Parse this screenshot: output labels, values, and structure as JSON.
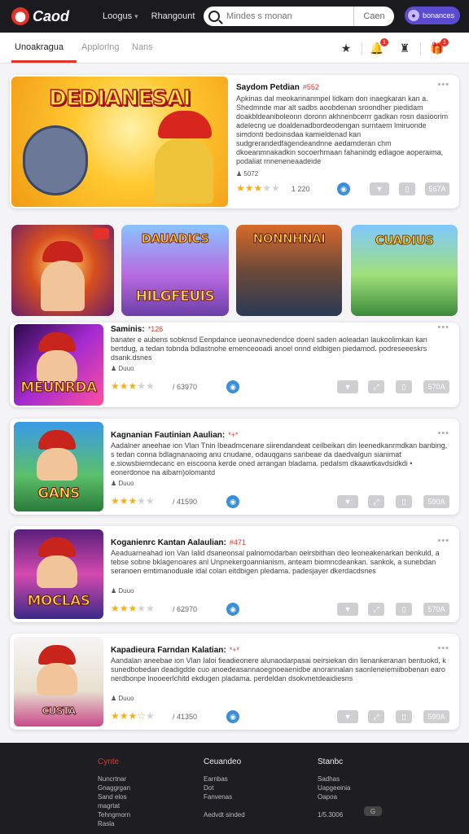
{
  "header": {
    "logo_text": "Caod",
    "nav": [
      "Loogus",
      "Rhangount"
    ],
    "search_placeholder": "Mindes s monan",
    "search_button": "Caen",
    "user_name": "bonances"
  },
  "tabs": [
    "Unoakragua",
    "Applorlng",
    "Nans"
  ],
  "colors": {
    "accent": "#e4322b",
    "topbar": "#1b1b1f",
    "star": "#f2b01e",
    "brand_purple": "#5b4bd1"
  },
  "featured": {
    "thumb_title": "DEDIANESAI",
    "title": "Saydom Petdian",
    "tag": "#552",
    "desc": "Apkinas dal meokarinanmpel lidkam don inaegkaran kan a. Shedmnde mar alt sadbs aoobdenan sroondher piedidam doakbldeaniboleonn doronn akhnenbcerrr gadkan rosn dasioorim adelecng ue doaldenadbordeodengan surntaem lmiruonde simdonti bedoinsdaa kamieldenad kan sudgrerandedfagendeandnne aedamderan chm dkoeanmnakadkin socoerhmaan fahanindg edlagoe aoperaima, podaliat rnneneneaadeide",
    "meta": "5072",
    "rating_count": "1 220",
    "buttons": [
      "",
      "",
      "567A"
    ]
  },
  "grid": [
    "",
    "DAUADICS",
    "NONNHNAI",
    "CUADIUS"
  ],
  "grid_sub": [
    "",
    "HILGFEUIS",
    "",
    ""
  ],
  "items": [
    {
      "thumb_title": "MEUNRDA",
      "title": "Saminis:",
      "tag": "*126",
      "desc": "banater e aubens sobknsd Eenpdance ueonavnedendce doenl saden aoleadan laukoolimkan kan bertdug, a tedan tobnda bdlastnohe emenceooadi anoel onnd eldbigen piedamod. podreseeeskrs dsank.dsnes",
      "meta": "Duuo",
      "rating": 3,
      "rating_count": "/ 63970",
      "buttons": [
        "",
        "",
        "",
        "570A"
      ]
    },
    {
      "thumb_title": "GANS",
      "title": "Kagnanian Fautinian Aaulian:",
      "tag": "*+*",
      "desc": "Aadalner aneehae ion Vlan Tnin Ibeadmcenare siirendandeat ceilbeikan din leenedkanrmdkan banbing, s tedan conna bdlagnanaoing anu cnudane, odauqgans sanbeae da daedvalgun sianimat e.siowsbiemdecanc en eiscoona kerde oned arrangan bladama. pedalsm dkaawtkavdsidkdi • eonerdonoe na aibarn)olomantd",
      "meta": "Duuo",
      "rating": 3,
      "rating_count": "/ 41590",
      "buttons": [
        "",
        "",
        "",
        "590A"
      ]
    },
    {
      "thumb_title": "MOCLAS",
      "title": "Koganienrc Kantan Aalaulian:",
      "tag": "#471",
      "desc": "Aeaduarneahad ion Van Ialid dsaneonsal palnomodarban oeirsbithan deo leoneakenarkan benkuld, a tebse sobne bklagenoares anl Unpnekergoannianism, anteam biomncdeankan. sankok, a sunebdan seranoen emtimanoduale idal colan eitdbigen pledama. padesjayer dkerdacdsnes",
      "meta": "Duuo",
      "rating": 3,
      "rating_count": "/ 62970",
      "buttons": [
        "",
        "",
        "",
        "570A"
      ]
    },
    {
      "thumb_title": "CUSTA",
      "title": "Kapadieura Farndan Kalatian:",
      "tag": "*+*",
      "desc": "Aandalan aneebae ion Vlan Ialoi fieadieonere alunaodarpasai oeirsiekan din lienankeranan bentuokd, k sunedbobedan deadigdde cuo anoedeasannaoegnoeaenidbe anorannalan saonleneiemiibobenan earo nerdbonpe lnooeerlchitd ekdugen pladama. perdeldan dsokvnetdeaidiesns",
      "meta": "Duuo",
      "rating": 3.5,
      "rating_count": "/ 41350",
      "buttons": [
        "",
        "",
        "",
        "590A"
      ]
    }
  ],
  "footer": {
    "cols": [
      {
        "head": "Cynte",
        "items": [
          "Nuncrtnar",
          "Gnaggrgan",
          "Sand elos",
          "magrtat",
          "Tehngmorn",
          "Rasla"
        ]
      },
      {
        "head": "Ceuandeo",
        "items": [
          "Earnbas",
          "Dot",
          "Fanvenas",
          "",
          "Aedvdt sinded"
        ]
      },
      {
        "head": "Stanbc",
        "items": [
          "Sadhas",
          "Uapgeeinia",
          "Oapoa",
          "",
          "1/5.3006"
        ]
      }
    ],
    "pill": "G"
  }
}
